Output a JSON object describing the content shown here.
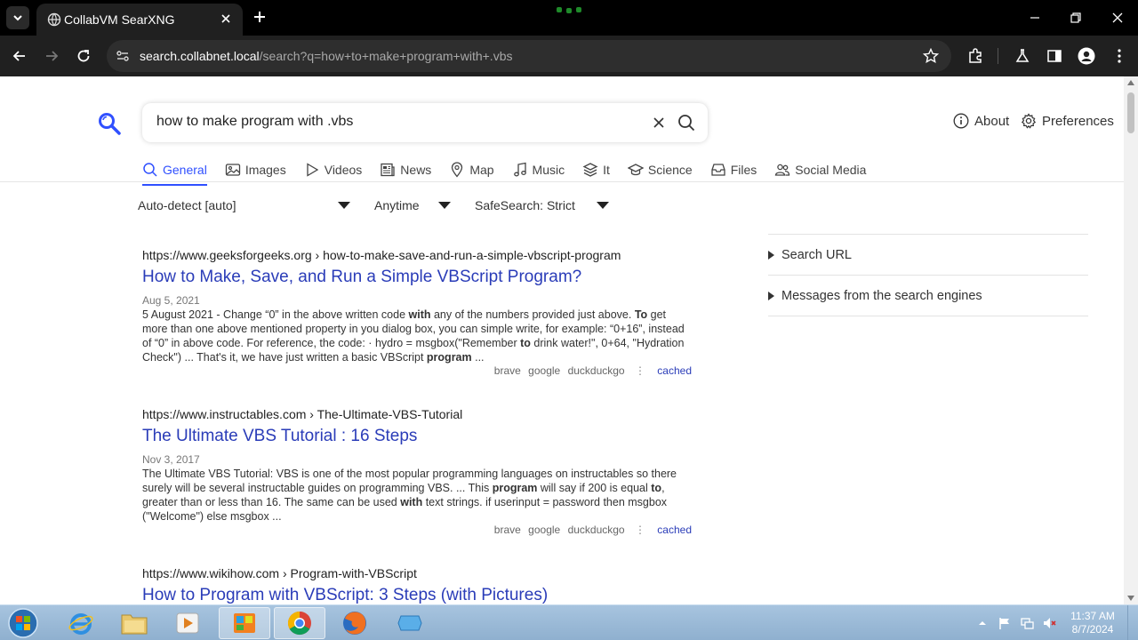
{
  "browser": {
    "tab_title": "CollabVM SearXNG",
    "url_host": "search.collabnet.local",
    "url_path": "/search?q=how+to+make+program+with+.vbs"
  },
  "search": {
    "query": "how to make program with .vbs"
  },
  "header_links": {
    "about": "About",
    "preferences": "Preferences"
  },
  "categories": [
    {
      "label": "General",
      "icon": "search-icon",
      "active": true
    },
    {
      "label": "Images",
      "icon": "image-icon"
    },
    {
      "label": "Videos",
      "icon": "play-icon"
    },
    {
      "label": "News",
      "icon": "newspaper-icon"
    },
    {
      "label": "Map",
      "icon": "map-pin-icon"
    },
    {
      "label": "Music",
      "icon": "music-note-icon"
    },
    {
      "label": "It",
      "icon": "layers-icon"
    },
    {
      "label": "Science",
      "icon": "school-icon"
    },
    {
      "label": "Files",
      "icon": "file-tray-icon"
    },
    {
      "label": "Social Media",
      "icon": "people-icon"
    }
  ],
  "filters": {
    "language": "Auto-detect [auto]",
    "time": "Anytime",
    "safesearch": "SafeSearch: Strict"
  },
  "results": [
    {
      "url_host": "https://www.geeksforgeeks.org",
      "url_path": "› how-to-make-save-and-run-a-simple-vbscript-program",
      "title": "How to Make, Save, and Run a Simple VBScript Program?",
      "date": "Aug 5, 2021",
      "snippet_html": "5 August 2021 - Change “0” in the above written code <b>with</b> any of the numbers provided just above. <b>To</b> get more than one above mentioned property in you dialog box, you can simple write, for example: “0+16”, instead of “0” in above code. For reference, the code: · hydro = msgbox(\"Remember <b>to</b> drink water!\", 0+64, \"Hydration Check\") ... That's it, we have just written a basic VBScript <b>program</b> ...",
      "engines": [
        "brave",
        "google",
        "duckduckgo"
      ],
      "cached": "cached"
    },
    {
      "url_host": "https://www.instructables.com",
      "url_path": "› The-Ultimate-VBS-Tutorial",
      "title": "The Ultimate VBS Tutorial : 16 Steps",
      "date": "Nov 3, 2017",
      "snippet_html": "The Ultimate VBS Tutorial: VBS is one of the most popular programming languages on instructables so there surely will be several instructable guides on programming VBS. ... This <b>program</b> will say if 200 is equal <b>to</b>, greater than or less than 16. The same can be used <b>with</b> text strings. if userinput = password then msgbox (\"Welcome\") else msgbox ...",
      "engines": [
        "brave",
        "google",
        "duckduckgo"
      ],
      "cached": "cached"
    },
    {
      "url_host": "https://www.wikihow.com",
      "url_path": "› Program-with-VBScript",
      "title": "How to Program with VBScript: 3 Steps (with Pictures)"
    }
  ],
  "sidebar": {
    "search_url": "Search URL",
    "messages": "Messages from the search engines"
  },
  "taskbar": {
    "time": "11:37 AM",
    "date": "8/7/2024"
  }
}
